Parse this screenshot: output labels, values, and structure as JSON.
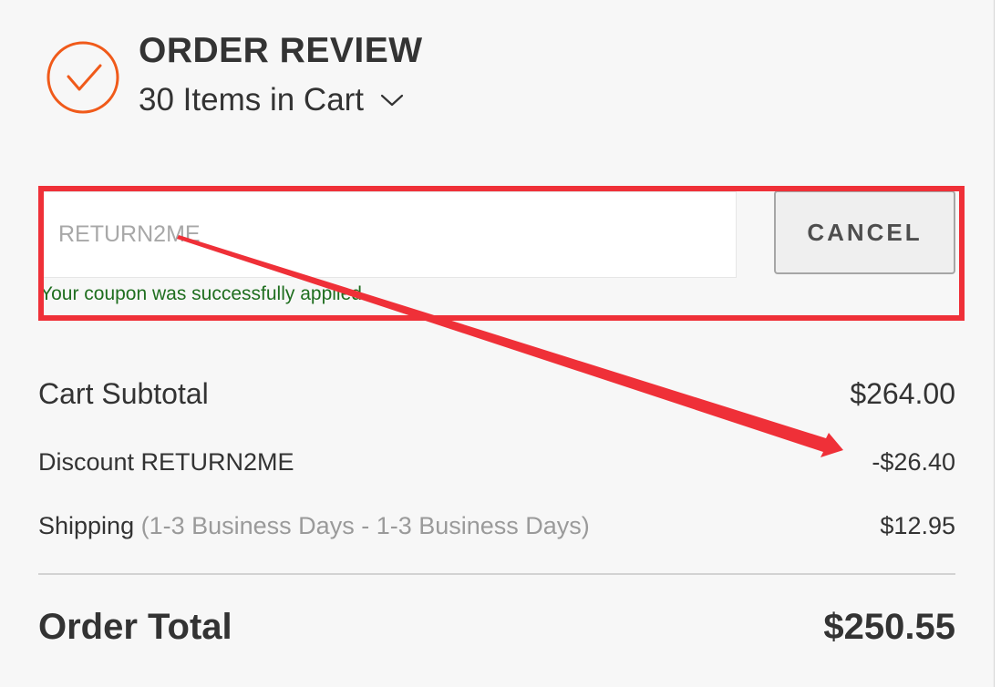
{
  "header": {
    "title": "ORDER REVIEW",
    "items_in_cart": "30 Items in Cart",
    "check_icon": "check-circle-icon",
    "chevron_icon": "chevron-down-icon"
  },
  "coupon": {
    "code_value": "RETURN2ME",
    "cancel_label": "CANCEL",
    "success_message": "Your coupon was successfully applied."
  },
  "summary": {
    "subtotal_label": "Cart Subtotal",
    "subtotal_value": "$264.00",
    "discount_label": "Discount RETURN2ME",
    "discount_value": "-$26.40",
    "shipping_label": "Shipping",
    "shipping_detail": "(1-3 Business Days - 1-3 Business Days)",
    "shipping_value": "$12.95",
    "total_label": "Order Total",
    "total_value": "$250.55"
  },
  "colors": {
    "accent_orange": "#f05a1a",
    "annotation_red": "#ef3038",
    "success_green": "#1f6e1f"
  }
}
